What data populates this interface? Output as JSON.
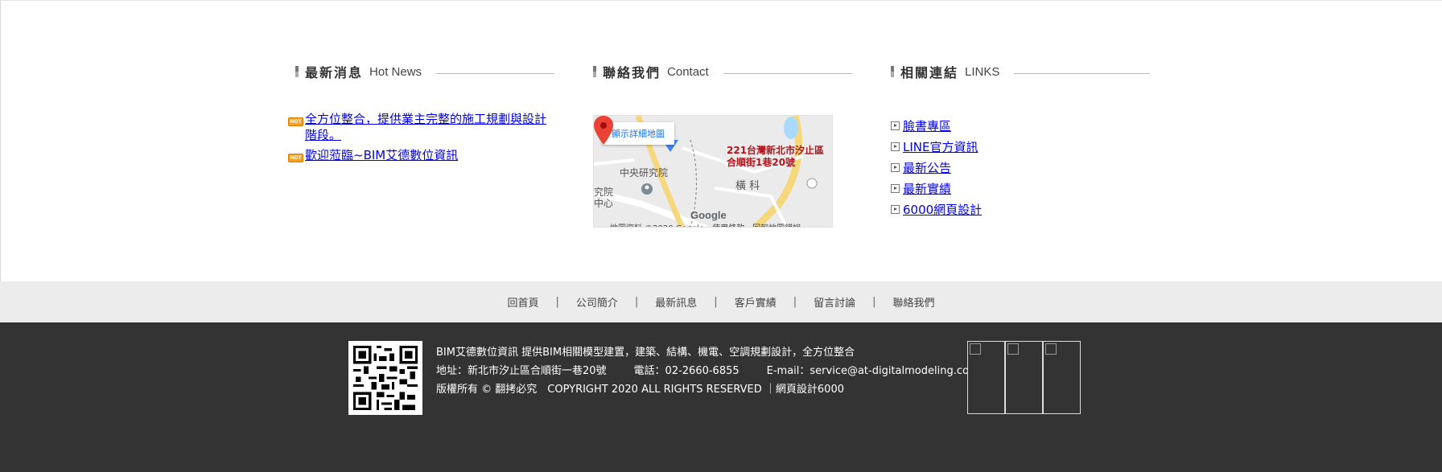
{
  "news": {
    "title_zh": "最新消息",
    "title_en": "Hot News",
    "badge": "HOT",
    "items": [
      "全方位整合，提供業主完整的施工規劃與設計階段。",
      "歡迎蒞臨~BIM艾德數位資訊"
    ]
  },
  "contact": {
    "title_zh": "聯絡我們",
    "title_en": "Contact",
    "map": {
      "button": "顯示詳細地圖",
      "address": "221台灣新北市汐止區合順街1巷20號",
      "labels": [
        "中央研究院",
        "橫 科",
        "究院",
        "中心"
      ],
      "brand": "Google",
      "footer": "地圖資料 ©2020 Google　使用條款　回報地圖錯誤"
    }
  },
  "links": {
    "title_zh": "相關連結",
    "title_en": "LINKS",
    "items": [
      "臉書專區",
      "LINE官方資訊",
      "最新公告",
      "最新實績",
      "6000網頁設計"
    ]
  },
  "nav": {
    "items": [
      "回首頁",
      "公司簡介",
      "最新訊息",
      "客戶實績",
      "留言討論",
      "聯絡我們"
    ],
    "separator": "|"
  },
  "footer": {
    "line1": "BIM艾德數位資訊 提供BIM相關模型建置，建築、結構、機電、空調規劃設計，全方位整合",
    "address": "地址：新北市汐止區合順街一巷20號",
    "phone": "電話：02-2660-6855",
    "email": "E-mail：service@at-digitalmodeling.com",
    "copyright": "版權所有 © 翻拷必究　COPYRIGHT 2020 ALL RIGHTS RESERVED ｜網頁設計6000"
  }
}
